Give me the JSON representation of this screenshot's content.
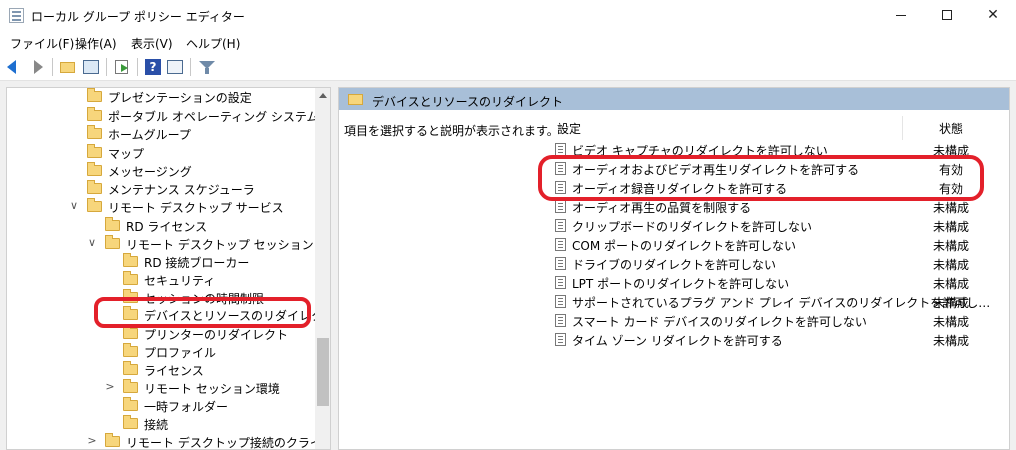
{
  "window": {
    "title": "ローカル グループ ポリシー エディター",
    "icon": "policy-editor-icon"
  },
  "menubar": {
    "items": [
      "ファイル(F)",
      "操作(A)",
      "表示(V)",
      "ヘルプ(H)"
    ]
  },
  "toolbar": {
    "buttons": [
      "back-icon",
      "forward-icon",
      "up-folder-icon",
      "show-hide-tree-icon",
      "export-list-icon",
      "help-icon",
      "extended-view-icon",
      "filter-icon"
    ]
  },
  "tree": {
    "items": [
      {
        "label": "プレゼンテーションの設定",
        "expander": ""
      },
      {
        "label": "ポータブル オペレーティング システム",
        "expander": ""
      },
      {
        "label": "ホームグループ",
        "expander": ""
      },
      {
        "label": "マップ",
        "expander": ""
      },
      {
        "label": "メッセージング",
        "expander": ""
      },
      {
        "label": "メンテナンス スケジューラ",
        "expander": ""
      },
      {
        "label": "リモート デスクトップ サービス",
        "expander": "∨"
      },
      {
        "label": "RD ライセンス",
        "expander": ""
      },
      {
        "label": "リモート デスクトップ セッション ホスト",
        "expander": "∨"
      },
      {
        "label": "RD 接続ブローカー",
        "expander": ""
      },
      {
        "label": "セキュリティ",
        "expander": ""
      },
      {
        "label": "セッションの時間制限",
        "expander": ""
      },
      {
        "label": "デバイスとリソースのリダイレクト",
        "expander": "",
        "selected": true
      },
      {
        "label": "プリンターのリダイレクト",
        "expander": ""
      },
      {
        "label": "プロファイル",
        "expander": ""
      },
      {
        "label": "ライセンス",
        "expander": ""
      },
      {
        "label": "リモート セッション環境",
        "expander": ">"
      },
      {
        "label": "一時フォルダー",
        "expander": ""
      },
      {
        "label": "接続",
        "expander": ""
      },
      {
        "label": "リモート デスクトップ接続のクライアント",
        "expander": ">"
      }
    ]
  },
  "content": {
    "header_title": "デバイスとリソースのリダイレクト",
    "description": "項目を選択すると説明が表示されます。",
    "columns": {
      "setting": "設定",
      "state": "状態"
    },
    "rows": [
      {
        "label": "ビデオ キャプチャのリダイレクトを許可しない",
        "state": "未構成"
      },
      {
        "label": "オーディオおよびビデオ再生リダイレクトを許可する",
        "state": "有効"
      },
      {
        "label": "オーディオ録音リダイレクトを許可する",
        "state": "有効"
      },
      {
        "label": "オーディオ再生の品質を制限する",
        "state": "未構成"
      },
      {
        "label": "クリップボードのリダイレクトを許可しない",
        "state": "未構成"
      },
      {
        "label": "COM ポートのリダイレクトを許可しない",
        "state": "未構成"
      },
      {
        "label": "ドライブのリダイレクトを許可しない",
        "state": "未構成"
      },
      {
        "label": "LPT ポートのリダイレクトを許可しない",
        "state": "未構成"
      },
      {
        "label": "サポートされているプラグ アンド プレイ デバイスのリダイレクトを許可し…",
        "state": "未構成"
      },
      {
        "label": "スマート カード デバイスのリダイレクトを許可しない",
        "state": "未構成"
      },
      {
        "label": "タイム ゾーン リダイレクトを許可する",
        "state": "未構成"
      }
    ]
  },
  "annotation_color": "#e3202a"
}
